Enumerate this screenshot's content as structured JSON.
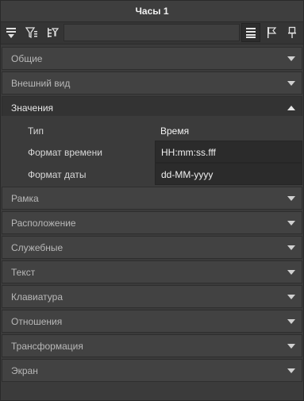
{
  "window": {
    "title": "Часы 1"
  },
  "toolbar": {
    "search_value": "",
    "left_icons": [
      "collapse-icon",
      "filter-icon",
      "tree-filter-icon"
    ],
    "right_icons": [
      "list-view-icon",
      "flag-icon",
      "pin-icon"
    ]
  },
  "sections": [
    {
      "label": "Общие",
      "open": false
    },
    {
      "label": "Внешний вид",
      "open": false
    },
    {
      "label": "Значения",
      "open": true
    },
    {
      "label": "Рамка",
      "open": false
    },
    {
      "label": "Расположение",
      "open": false
    },
    {
      "label": "Служебные",
      "open": false
    },
    {
      "label": "Текст",
      "open": false
    },
    {
      "label": "Клавиатура",
      "open": false
    },
    {
      "label": "Отношения",
      "open": false
    },
    {
      "label": "Трансформация",
      "open": false
    },
    {
      "label": "Экран",
      "open": false
    }
  ],
  "values": {
    "type_label": "Тип",
    "type_value": "Время",
    "time_format_label": "Формат времени",
    "time_format_value": "HH:mm:ss.fff",
    "date_format_label": "Формат даты",
    "date_format_value": "dd-MM-yyyy"
  }
}
